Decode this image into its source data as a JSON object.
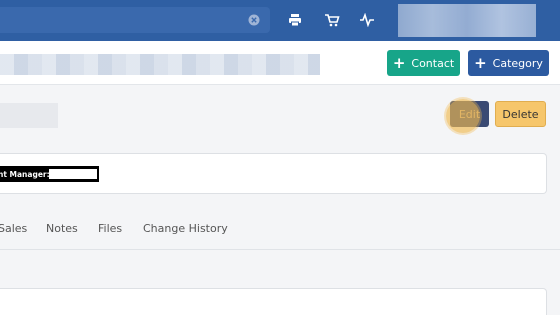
{
  "topbar": {
    "search": {
      "value": "",
      "placeholder": ""
    },
    "icons": [
      "print-icon",
      "cart-icon",
      "activity-icon"
    ]
  },
  "header": {
    "buttons": {
      "contact": "Contact",
      "category": "Category"
    }
  },
  "record": {
    "edit_label": "Edit",
    "delete_label": "Delete",
    "manager_label": "nt Manager:"
  },
  "tabs": [
    "Sales",
    "Notes",
    "Files",
    "Change History"
  ],
  "colors": {
    "topbar": "#2f5fa3",
    "contact_button": "#17a589",
    "category_button": "#2c5aa0",
    "delete_button": "#f6c66b",
    "edit_button": "#3a4a73"
  }
}
